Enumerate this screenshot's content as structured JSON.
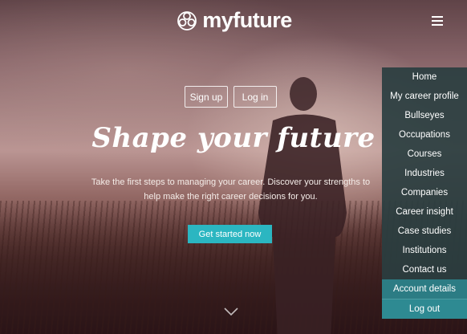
{
  "header": {
    "logo_text": "myfuture",
    "menu_icon": "hamburger-icon"
  },
  "auth": {
    "signup_label": "Sign up",
    "login_label": "Log in"
  },
  "hero": {
    "headline": "Shape your future",
    "tagline": "Take the first steps to managing your career. Discover your strengths to help make the right career decisions for you.",
    "cta_label": "Get started now",
    "scroll_icon": "chevron-down-icon"
  },
  "menu": {
    "items": [
      {
        "label": "Home"
      },
      {
        "label": "My career profile"
      },
      {
        "label": "Bullseyes"
      },
      {
        "label": "Occupations"
      },
      {
        "label": "Courses"
      },
      {
        "label": "Industries"
      },
      {
        "label": "Companies"
      },
      {
        "label": "Career insight"
      },
      {
        "label": "Case studies"
      },
      {
        "label": "Institutions"
      },
      {
        "label": "Contact us"
      },
      {
        "label": "Account details"
      },
      {
        "label": "Log out"
      }
    ]
  },
  "colors": {
    "accent": "#2bb6c1",
    "menu_bg": "#2a3e40",
    "menu_highlight": "#2c7c84"
  }
}
